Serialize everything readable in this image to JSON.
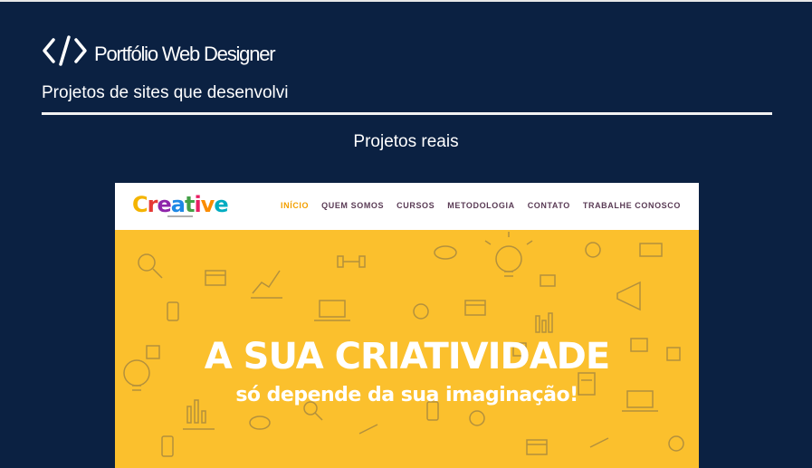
{
  "header": {
    "title": "Portfólio Web Designer",
    "icon": "code-icon",
    "subtitle": "Projetos de sites que desenvolvi"
  },
  "section": {
    "title": "Projetos reais"
  },
  "project_preview": {
    "logo_letters": [
      "C",
      "r",
      "e",
      "a",
      "t",
      "i",
      "v",
      "e"
    ],
    "logo_colors": [
      "#f4b400",
      "#e53935",
      "#8e24aa",
      "#1e88e5",
      "#43a047",
      "#e91e63",
      "#fb8c00",
      "#00acc1"
    ],
    "menu": [
      "INÍCIO",
      "QUEM SOMOS",
      "CURSOS",
      "METODOLOGIA",
      "CONTATO",
      "TRABALHE CONOSCO"
    ],
    "active_menu": "INÍCIO",
    "hero_title": "A SUA CRIATIVIDADE",
    "hero_subtitle": "só depende da sua imaginação!",
    "hero_color": "#fbc02d"
  },
  "colors": {
    "background": "#0b2142",
    "text": "#ffffff"
  }
}
